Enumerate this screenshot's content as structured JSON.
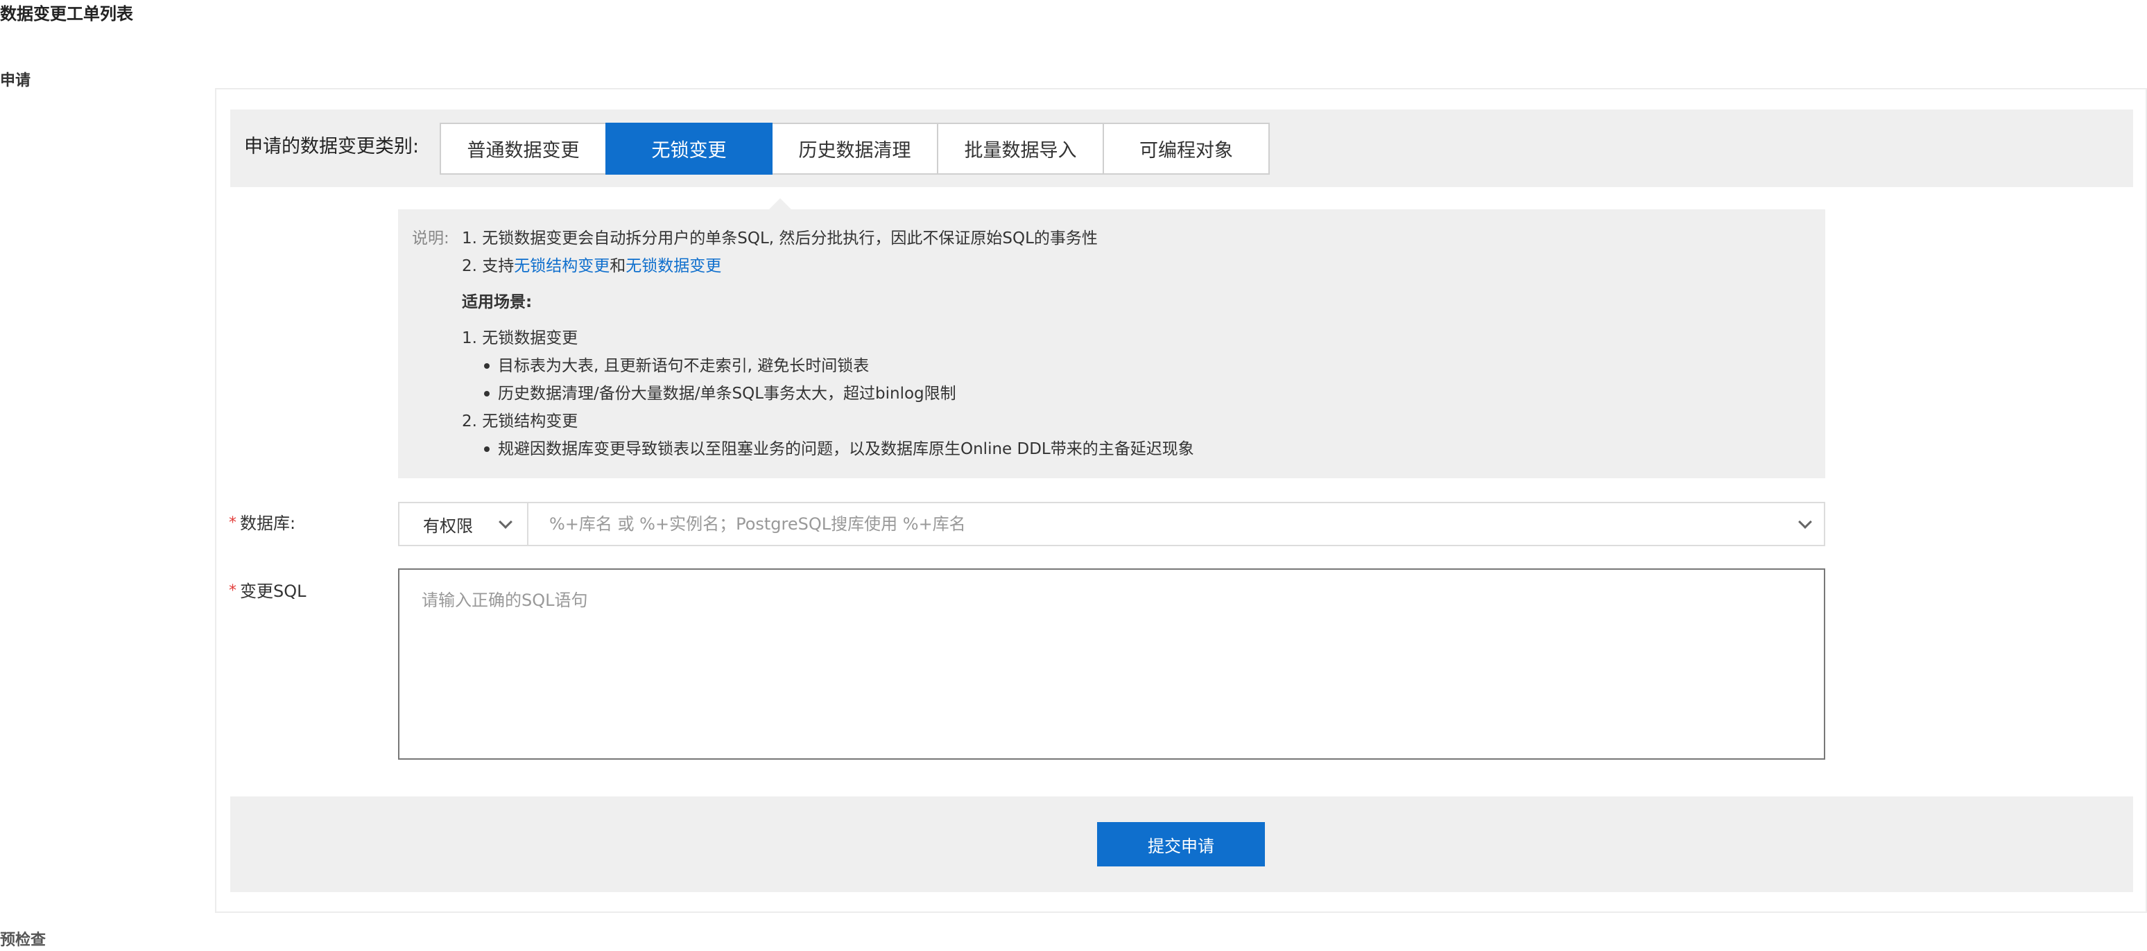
{
  "page": {
    "title": "数据变更工单列表",
    "step_apply": "申请",
    "step_precheck": "预检查"
  },
  "change_type": {
    "label": "申请的数据变更类别:",
    "tabs": [
      "普通数据变更",
      "无锁变更",
      "历史数据清理",
      "批量数据导入",
      "可编程对象"
    ],
    "active": "无锁变更"
  },
  "description": {
    "prefix": "说明:",
    "line1": "1. 无锁数据变更会自动拆分用户的单条SQL, 然后分批执行，因此不保证原始SQL的事务性",
    "line2_prefix": "2. 支持",
    "line2_link1": "无锁结构变更",
    "line2_and": "和",
    "line2_link2": "无锁数据变更",
    "scenarios_title": "适用场景:",
    "s1_title": "1. 无锁数据变更",
    "s1_b1": "目标表为大表, 且更新语句不走索引, 避免长时间锁表",
    "s1_b2": "历史数据清理/备份大量数据/单条SQL事务太大，超过binlog限制",
    "s2_title": "2. 无锁结构变更",
    "s2_b1": "规避因数据库变更导致锁表以至阻塞业务的问题，以及数据库原生Online DDL带来的主备延迟现象"
  },
  "database": {
    "required_mark": "*",
    "label": "数据库:",
    "scope_value": "有权限",
    "placeholder": "%+库名 或 %+实例名；PostgreSQL搜库使用 %+库名",
    "value": ""
  },
  "sql": {
    "required_mark": "*",
    "label": "变更SQL",
    "placeholder": "请输入正确的SQL语句",
    "value": ""
  },
  "submit_label": "提交申请",
  "colors": {
    "primary": "#0f6fcd",
    "required": "#e23c39",
    "panel_bg": "#efefef"
  }
}
